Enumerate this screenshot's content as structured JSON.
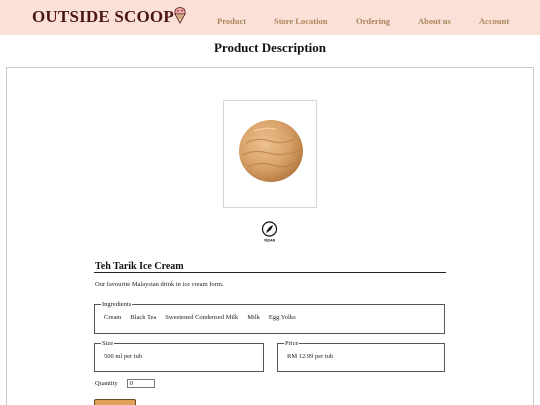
{
  "nav": {
    "brand": "OUTSIDE SCOOP",
    "links": [
      "Product",
      "Store Location",
      "Ordering",
      "About us",
      "Account"
    ]
  },
  "page": {
    "title": "Product Description"
  },
  "product": {
    "name": "Teh Tarik Ice Cream",
    "description": "Our favourite Malaysian drink in ice cream form.",
    "ingredients_legend": "Ingredients",
    "ingredients": [
      "Cream",
      "Black Tea",
      "Sweetened Condensed Milk",
      "Milk",
      "Egg Yolks"
    ],
    "size_legend": "Size",
    "size": "500 ml per tub",
    "price_legend": "Price",
    "price": "RM 12.99 per tub",
    "quantity_label": "Quantity",
    "quantity_value": "0",
    "vegan_label": "VEGAN"
  },
  "colors": {
    "nav_bg": "#fbe0d8",
    "brand": "#4a1616",
    "nav_link": "#a8865a",
    "button": "#e0a258",
    "ice_cream": "#d9a26a"
  }
}
